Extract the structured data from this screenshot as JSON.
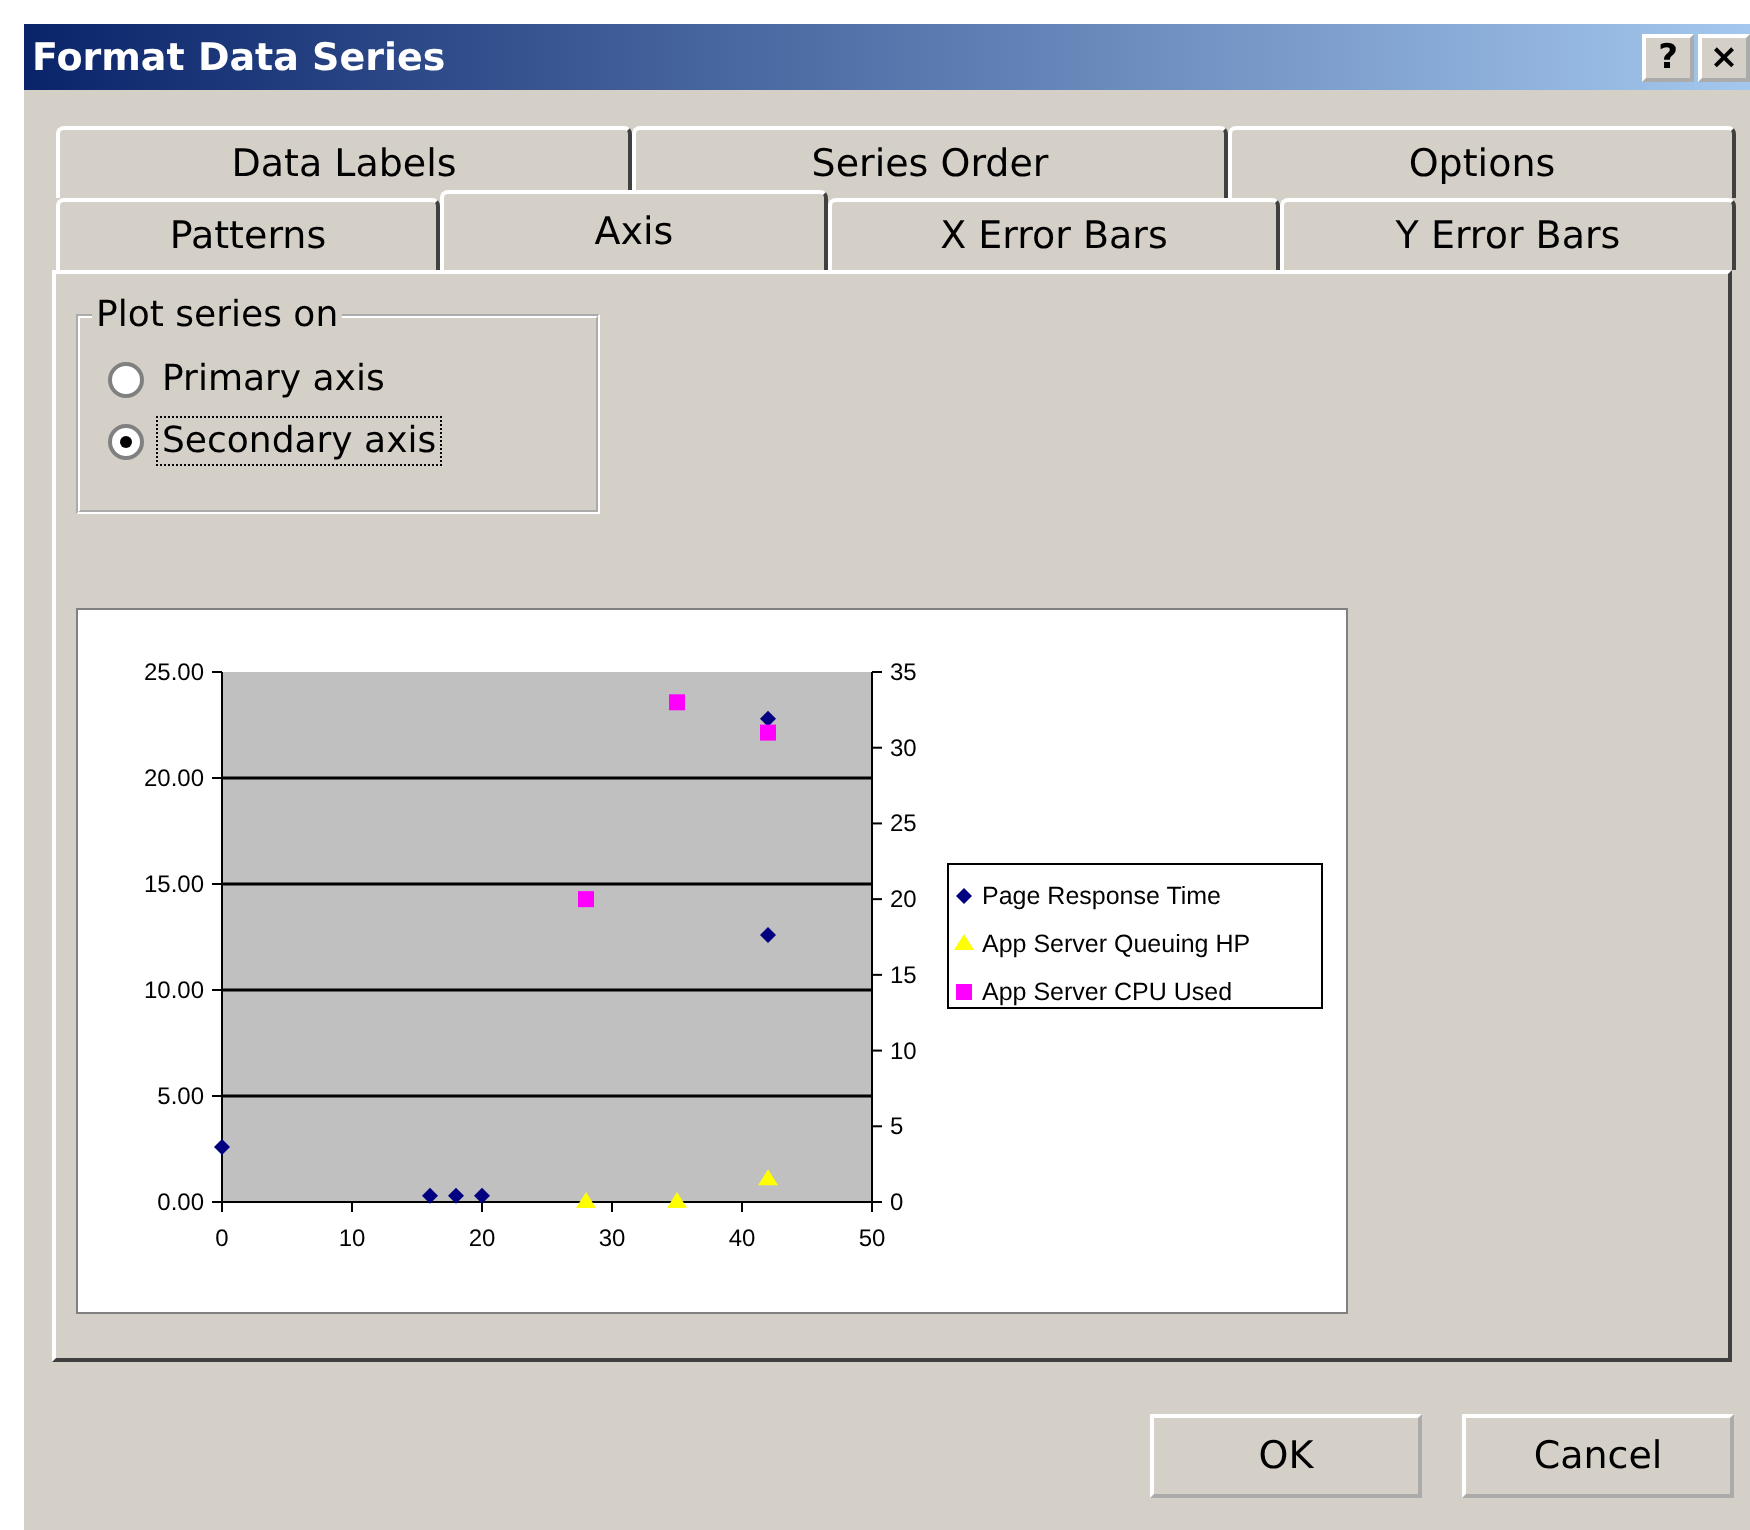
{
  "window": {
    "title": "Format Data Series",
    "title_buttons": [
      "?",
      "×"
    ]
  },
  "tabs": [
    [
      {
        "label": "Data Labels",
        "selected": false
      },
      {
        "label": "Series Order",
        "selected": false
      },
      {
        "label": "Options",
        "selected": false
      }
    ],
    [
      {
        "label": "Patterns",
        "selected": false
      },
      {
        "label": "Axis",
        "selected": true
      },
      {
        "label": "X Error Bars",
        "selected": false
      },
      {
        "label": "Y Error Bars",
        "selected": false
      }
    ]
  ],
  "plot_series_on": {
    "label": "Plot series on",
    "options": [
      {
        "label": "Primary axis",
        "selected": false,
        "focused": false
      },
      {
        "label": "Secondary axis",
        "selected": true,
        "focused": true
      }
    ]
  },
  "chart": {
    "chart_data": {
      "type": "scatter",
      "xlim": [
        0,
        50
      ],
      "ylim": [
        0,
        25
      ],
      "xticks": [
        0,
        10,
        20,
        30,
        40,
        50
      ],
      "yticks": [
        {
          "value": 0,
          "label": "0.00"
        },
        {
          "value": 5,
          "label": "5.00"
        },
        {
          "value": 10,
          "label": "10.00"
        },
        {
          "value": 15,
          "label": "15.00"
        },
        {
          "value": 20,
          "label": "20.00"
        },
        {
          "value": 25,
          "label": "25.00"
        }
      ],
      "grid": "y",
      "legend": "right",
      "y2lim": [
        0,
        35
      ],
      "y2ticks": [
        0,
        5,
        10,
        15,
        20,
        25,
        30,
        35
      ],
      "series": [
        {
          "name": "Page Response Time",
          "color": "#000080",
          "marker": "diamond",
          "x": [
            0,
            16,
            18,
            20,
            42,
            42
          ],
          "values": [
            2.6,
            0.3,
            0.3,
            0.3,
            22.8,
            12.6
          ]
        },
        {
          "name": "App Server Queuing HP",
          "color": "#ffff00",
          "marker": "triangle",
          "axis": "y2",
          "x": [
            28,
            35,
            42
          ],
          "values": [
            0,
            0,
            1.5
          ]
        },
        {
          "name": "App Server CPU Used",
          "color": "#ff00ff",
          "marker": "square",
          "axis": "y2",
          "x": [
            28,
            35,
            42
          ],
          "values": [
            20,
            33,
            31
          ]
        }
      ]
    }
  },
  "buttons": [
    {
      "label": "OK"
    },
    {
      "label": "Cancel"
    }
  ]
}
